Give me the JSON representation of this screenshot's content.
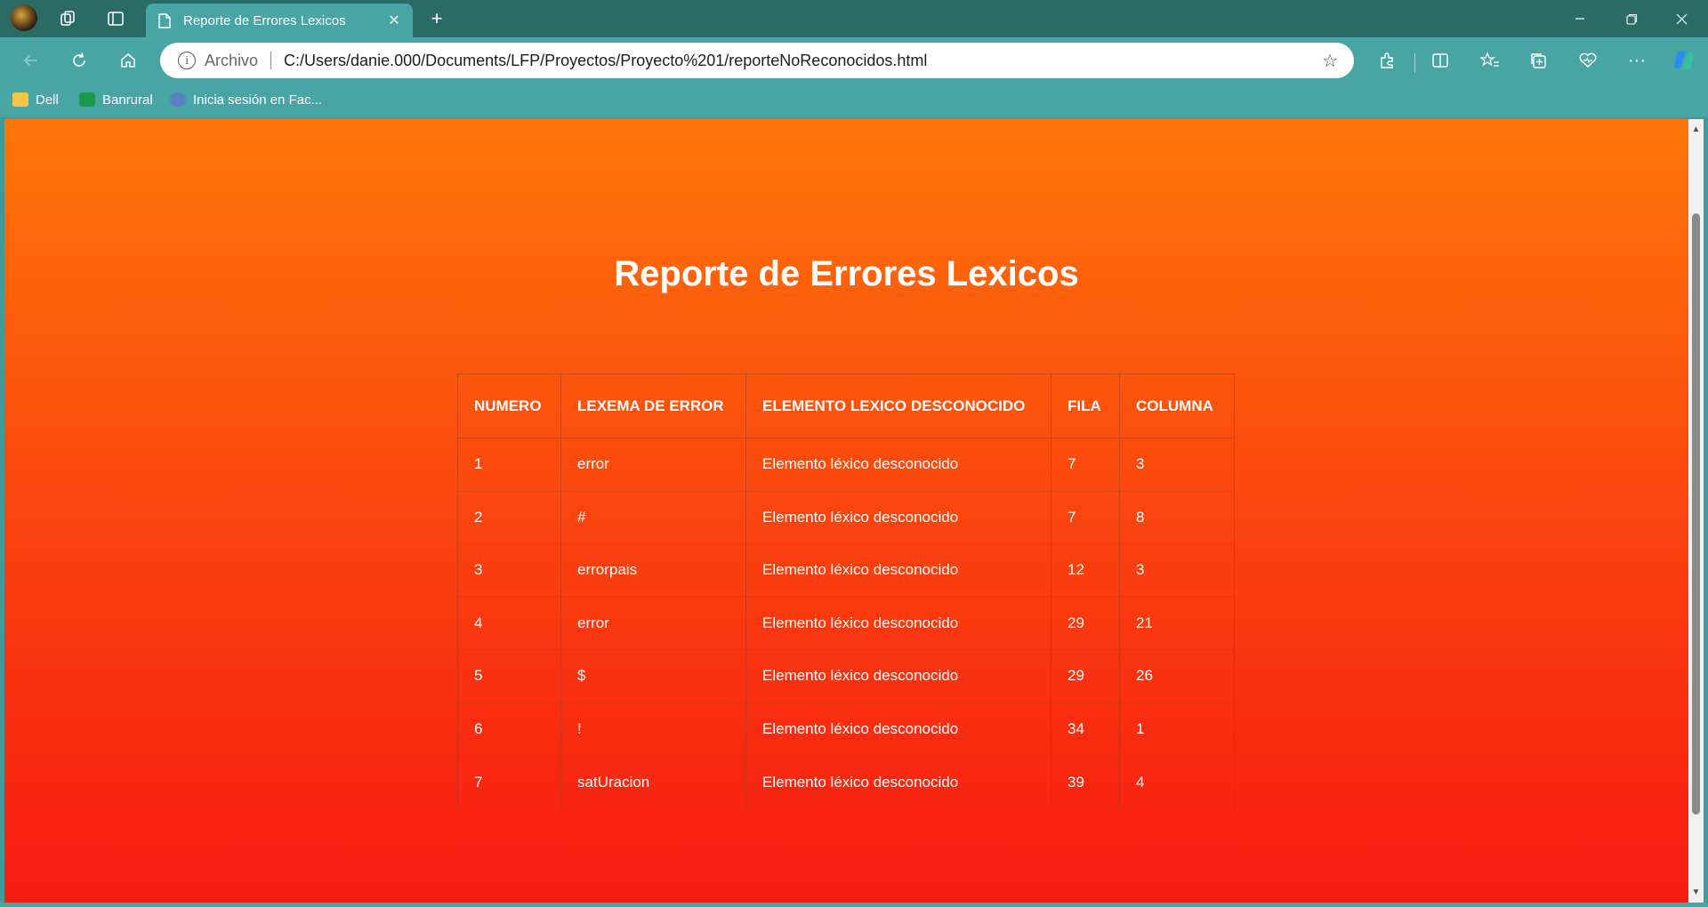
{
  "browser": {
    "tab": {
      "title": "Reporte de Errores Lexicos"
    },
    "address": {
      "protocol_label": "Archivo",
      "url": "C:/Users/danie.000/Documents/LFP/Proyectos/Proyecto%201/reporteNoReconocidos.html"
    },
    "bookmarks": [
      {
        "label": "Dell",
        "icon": "folder-icon",
        "color": "#f4c542"
      },
      {
        "label": "Banrural",
        "icon": "banrural-icon",
        "color": "#1a9b4b"
      },
      {
        "label": "Inicia sesión en Fac...",
        "icon": "facebook-login-icon",
        "color": "#5b7fc2"
      }
    ],
    "accent_colors": {
      "titlebar": "#2b6b66",
      "toolbar": "#48a5a3"
    }
  },
  "page": {
    "title": "Reporte de Errores Lexicos",
    "table": {
      "headers": [
        "NUMERO",
        "LEXEMA DE ERROR",
        "ELEMENTO LEXICO DESCONOCIDO",
        "FILA",
        "COLUMNA"
      ],
      "rows": [
        [
          "1",
          "error",
          "Elemento léxico desconocido",
          "7",
          "3"
        ],
        [
          "2",
          "#",
          "Elemento léxico desconocido",
          "7",
          "8"
        ],
        [
          "3",
          "errorpais",
          "Elemento léxico desconocido",
          "12",
          "3"
        ],
        [
          "4",
          "error",
          "Elemento léxico desconocido",
          "29",
          "21"
        ],
        [
          "5",
          "$",
          "Elemento léxico desconocido",
          "29",
          "26"
        ],
        [
          "6",
          "!",
          "Elemento léxico desconocido",
          "34",
          "1"
        ],
        [
          "7",
          "satUracion",
          "Elemento léxico desconocido",
          "39",
          "4"
        ]
      ]
    },
    "background_gradient": [
      "#ff7608",
      "#f71c12"
    ]
  }
}
